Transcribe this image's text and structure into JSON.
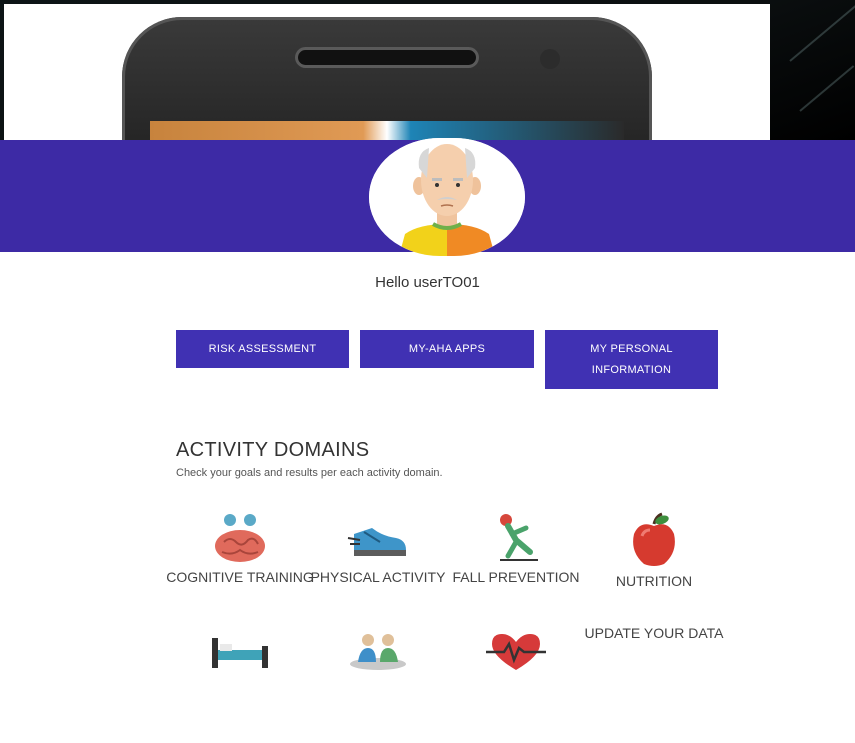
{
  "greeting": "Hello userTO01",
  "buttons": {
    "risk_assessment": "RISK ASSESSMENT",
    "my_aha_apps": "MY-AHA APPS",
    "my_personal_information": "MY PERSONAL INFORMATION"
  },
  "activity": {
    "title": "ACTIVITY DOMAINS",
    "subtitle": "Check your goals and results per each activity domain."
  },
  "domains": [
    {
      "label": "COGNITIVE TRAINING",
      "icon": "brain-icon"
    },
    {
      "label": "PHYSICAL ACTIVITY",
      "icon": "sneaker-icon"
    },
    {
      "label": "FALL PREVENTION",
      "icon": "falling-person-icon"
    },
    {
      "label": "NUTRITION",
      "icon": "apple-icon"
    },
    {
      "label": "",
      "icon": "bed-icon"
    },
    {
      "label": "",
      "icon": "social-people-icon"
    },
    {
      "label": "",
      "icon": "heartbeat-icon"
    },
    {
      "label": "UPDATE YOUR DATA",
      "icon": ""
    }
  ],
  "colors": {
    "primary": "#3d2aa5",
    "button": "#4031b3"
  }
}
